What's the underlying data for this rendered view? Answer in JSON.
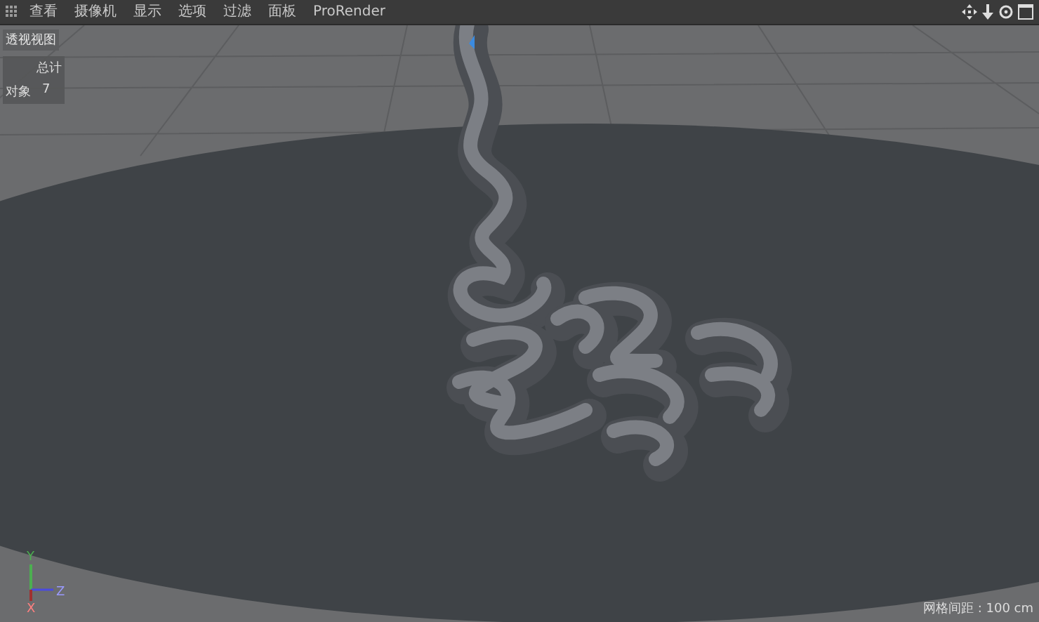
{
  "menu_bar": {
    "items": [
      "查看",
      "摄像机",
      "显示",
      "选项",
      "过滤",
      "面板",
      "ProRender"
    ]
  },
  "viewport": {
    "title": "透视视图",
    "stats": {
      "heading": "总计",
      "rows": [
        {
          "label": "对象",
          "value": "7"
        }
      ]
    },
    "axes": {
      "y": "Y",
      "z": "Z",
      "x": "X"
    },
    "grid_spacing": "网格间距 : 100 cm"
  }
}
